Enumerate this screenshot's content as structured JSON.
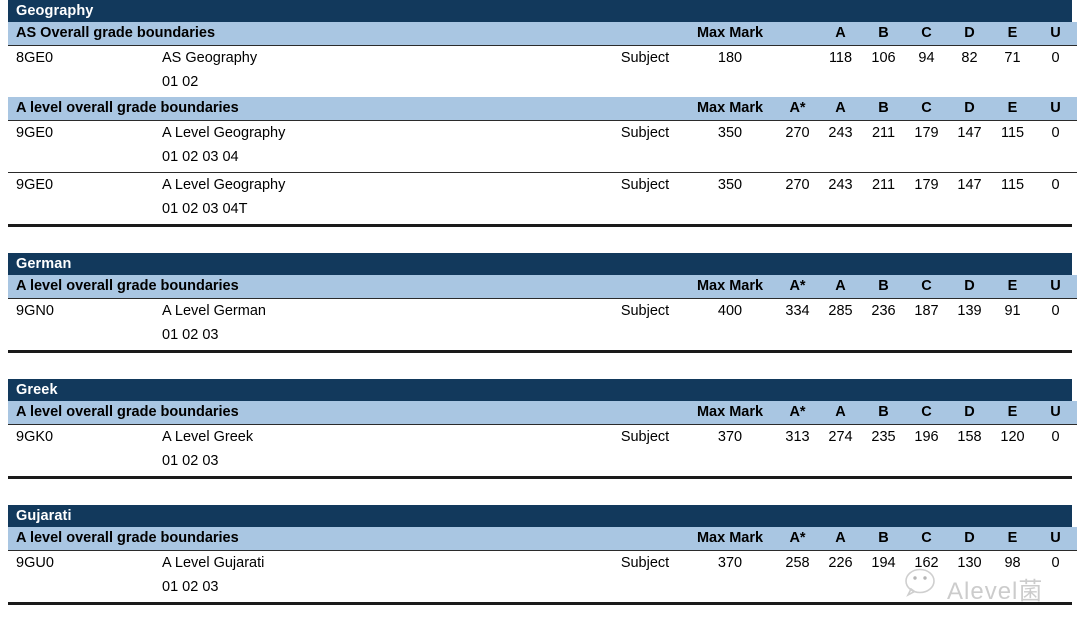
{
  "document": {
    "column_headers": {
      "max_mark": "Max Mark",
      "a_star": "A*",
      "a": "A",
      "b": "B",
      "c": "C",
      "d": "D",
      "e": "E",
      "u": "U"
    },
    "level_label": "Subject",
    "colors": {
      "subject_bar": "#12395c",
      "boundary_header": "#a9c6e2",
      "rule": "#1a1a1a",
      "page_background": "#ffffff",
      "watermark": "#b9b9b9"
    }
  },
  "watermark": {
    "text": "Alevel菌",
    "logo": "wechat-icon"
  },
  "sections": [
    {
      "subject": "Geography",
      "tables": [
        {
          "boundary_label": "AS Overall grade boundaries",
          "has_a_star": false,
          "rows": [
            {
              "code": "8GE0",
              "title": "AS Geography",
              "units": "01 02",
              "level": "Subject",
              "max_mark": "180",
              "grades": {
                "a_star": "",
                "a": "118",
                "b": "106",
                "c": "94",
                "d": "82",
                "e": "71",
                "u": "0"
              }
            }
          ]
        },
        {
          "boundary_label": "A level overall grade boundaries",
          "has_a_star": true,
          "rows": [
            {
              "code": "9GE0",
              "title": "A Level Geography",
              "units": "01 02 03 04",
              "level": "Subject",
              "max_mark": "350",
              "grades": {
                "a_star": "270",
                "a": "243",
                "b": "211",
                "c": "179",
                "d": "147",
                "e": "115",
                "u": "0"
              }
            },
            {
              "code": "9GE0",
              "title": "A Level Geography",
              "units": "01 02 03 04T",
              "level": "Subject",
              "max_mark": "350",
              "grades": {
                "a_star": "270",
                "a": "243",
                "b": "211",
                "c": "179",
                "d": "147",
                "e": "115",
                "u": "0"
              }
            }
          ]
        }
      ]
    },
    {
      "subject": "German",
      "tables": [
        {
          "boundary_label": "A level overall grade boundaries",
          "has_a_star": true,
          "rows": [
            {
              "code": "9GN0",
              "title": "A Level German",
              "units": "01 02 03",
              "level": "Subject",
              "max_mark": "400",
              "grades": {
                "a_star": "334",
                "a": "285",
                "b": "236",
                "c": "187",
                "d": "139",
                "e": "91",
                "u": "0"
              }
            }
          ]
        }
      ]
    },
    {
      "subject": "Greek",
      "tables": [
        {
          "boundary_label": "A level overall grade boundaries",
          "has_a_star": true,
          "rows": [
            {
              "code": "9GK0",
              "title": "A Level Greek",
              "units": "01 02 03",
              "level": "Subject",
              "max_mark": "370",
              "grades": {
                "a_star": "313",
                "a": "274",
                "b": "235",
                "c": "196",
                "d": "158",
                "e": "120",
                "u": "0"
              }
            }
          ]
        }
      ]
    },
    {
      "subject": "Gujarati",
      "tables": [
        {
          "boundary_label": "A level overall grade boundaries",
          "has_a_star": true,
          "rows": [
            {
              "code": "9GU0",
              "title": "A Level Gujarati",
              "units": "01 02 03",
              "level": "Subject",
              "max_mark": "370",
              "grades": {
                "a_star": "258",
                "a": "226",
                "b": "194",
                "c": "162",
                "d": "130",
                "e": "98",
                "u": "0"
              }
            }
          ]
        }
      ]
    }
  ]
}
